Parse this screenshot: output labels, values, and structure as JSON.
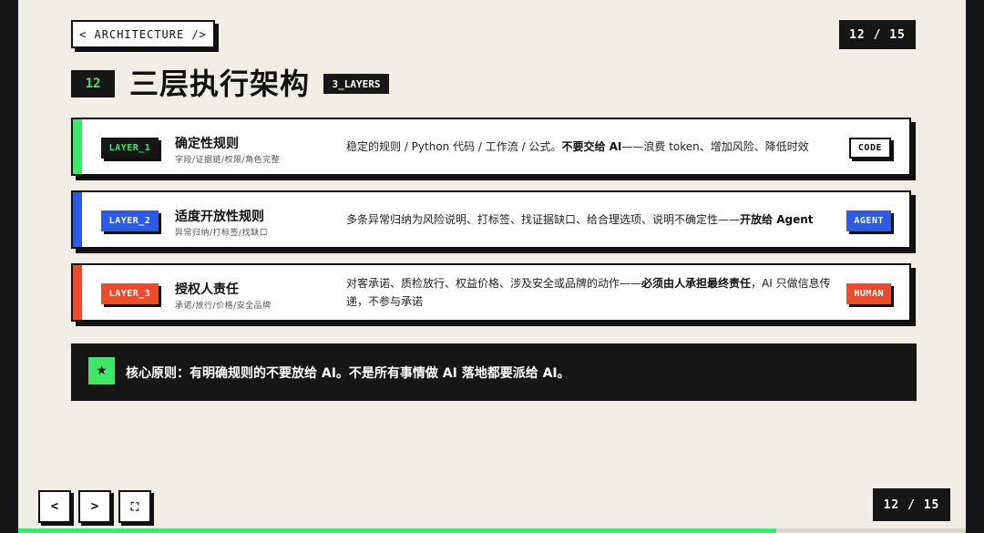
{
  "header": {
    "section_tag": "< ARCHITECTURE />",
    "counter": "12 / 15"
  },
  "title": {
    "number": "12",
    "text": "三层执行架构",
    "badge": "3_LAYERS"
  },
  "layers": [
    {
      "tag": "LAYER_1",
      "name": "确定性规则",
      "sub": "字段/证据链/权限/角色完整",
      "desc_pre": "稳定的规则 / Python 代码 / 工作流 / 公式。",
      "desc_bold": "不要交给 AI",
      "desc_post": "——浪费 token、增加风险、降低时效",
      "role": "CODE",
      "color": "#3ee86a"
    },
    {
      "tag": "LAYER_2",
      "name": "适度开放性规则",
      "sub": "异常归纳/打标签/找缺口",
      "desc_pre": "多条异常归纳为风险说明、打标签、找证据缺口、给合理选项、说明不确定性——",
      "desc_bold": "开放给 Agent",
      "desc_post": "",
      "role": "AGENT",
      "color": "#2e5be6"
    },
    {
      "tag": "LAYER_3",
      "name": "授权人责任",
      "sub": "承诺/放行/价格/安全品牌",
      "desc_pre": "对客承诺、质检放行、权益价格、涉及安全或品牌的动作——",
      "desc_bold": "必须由人承担最终责任",
      "desc_post": "，AI 只做信息传递，不参与承诺",
      "role": "HUMAN",
      "color": "#f04a2c"
    }
  ],
  "principle": {
    "icon": "star-icon",
    "icon_glyph": "★",
    "text": "核心原则：有明确规则的不要放给 AI。不是所有事情做 AI 落地都要派给 AI。"
  },
  "nav": {
    "prev": "<",
    "next": ">",
    "fullscreen": "⛶",
    "counter": "12 / 15",
    "progress": 0.8
  },
  "colors": {
    "accent_green": "#3ee86a",
    "accent_blue": "#2e5be6",
    "accent_red": "#f04a2c",
    "background": "#f1eee7",
    "dark": "#161616"
  }
}
